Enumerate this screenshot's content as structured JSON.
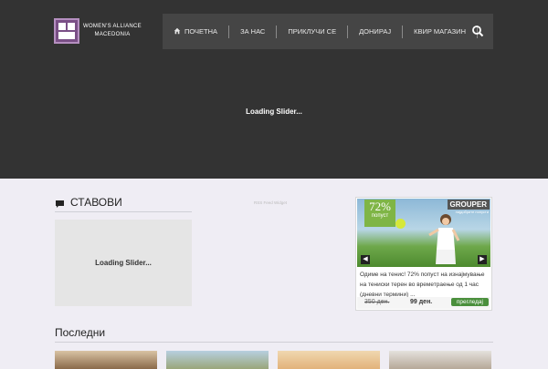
{
  "brand": {
    "line1": "WOMEN'S ALLIANCE",
    "line2": "MACEDONIA"
  },
  "nav": {
    "items": [
      {
        "label": "ПОЧЕТНА",
        "icon": "home-icon"
      },
      {
        "label": "ЗА НАС"
      },
      {
        "label": "ПРИКЛУЧИ СЕ"
      },
      {
        "label": "ДОНИРАЈ"
      },
      {
        "label": "КВИР МАГАЗИН"
      }
    ],
    "search_icon": "search-icon"
  },
  "hero": {
    "loading": "Loading Slider..."
  },
  "views": {
    "title": "СТАВОВИ",
    "icon": "speech-bubble-icon",
    "loading": "Loading Slider..."
  },
  "rss": {
    "label": "RSS Feed Widget"
  },
  "deal": {
    "percent": "72%",
    "off_label": "попуст",
    "brand": "GROUPER",
    "brand_sub": "најдобрите попусти",
    "description": "Одиме на тенис! 72% попуст на изнајмување на тениски терен во времетраење од 1 час (дневни термини) ...",
    "old_price": "350 ден.",
    "new_price": "99 ден.",
    "button": "прегледај"
  },
  "latest": {
    "title": "Последни"
  },
  "colors": {
    "hero_bg": "#333333",
    "nav_bg": "#454545",
    "page_bg": "#efedf4",
    "accent_purple": "#7a4f86",
    "deal_green": "#7fb546"
  }
}
